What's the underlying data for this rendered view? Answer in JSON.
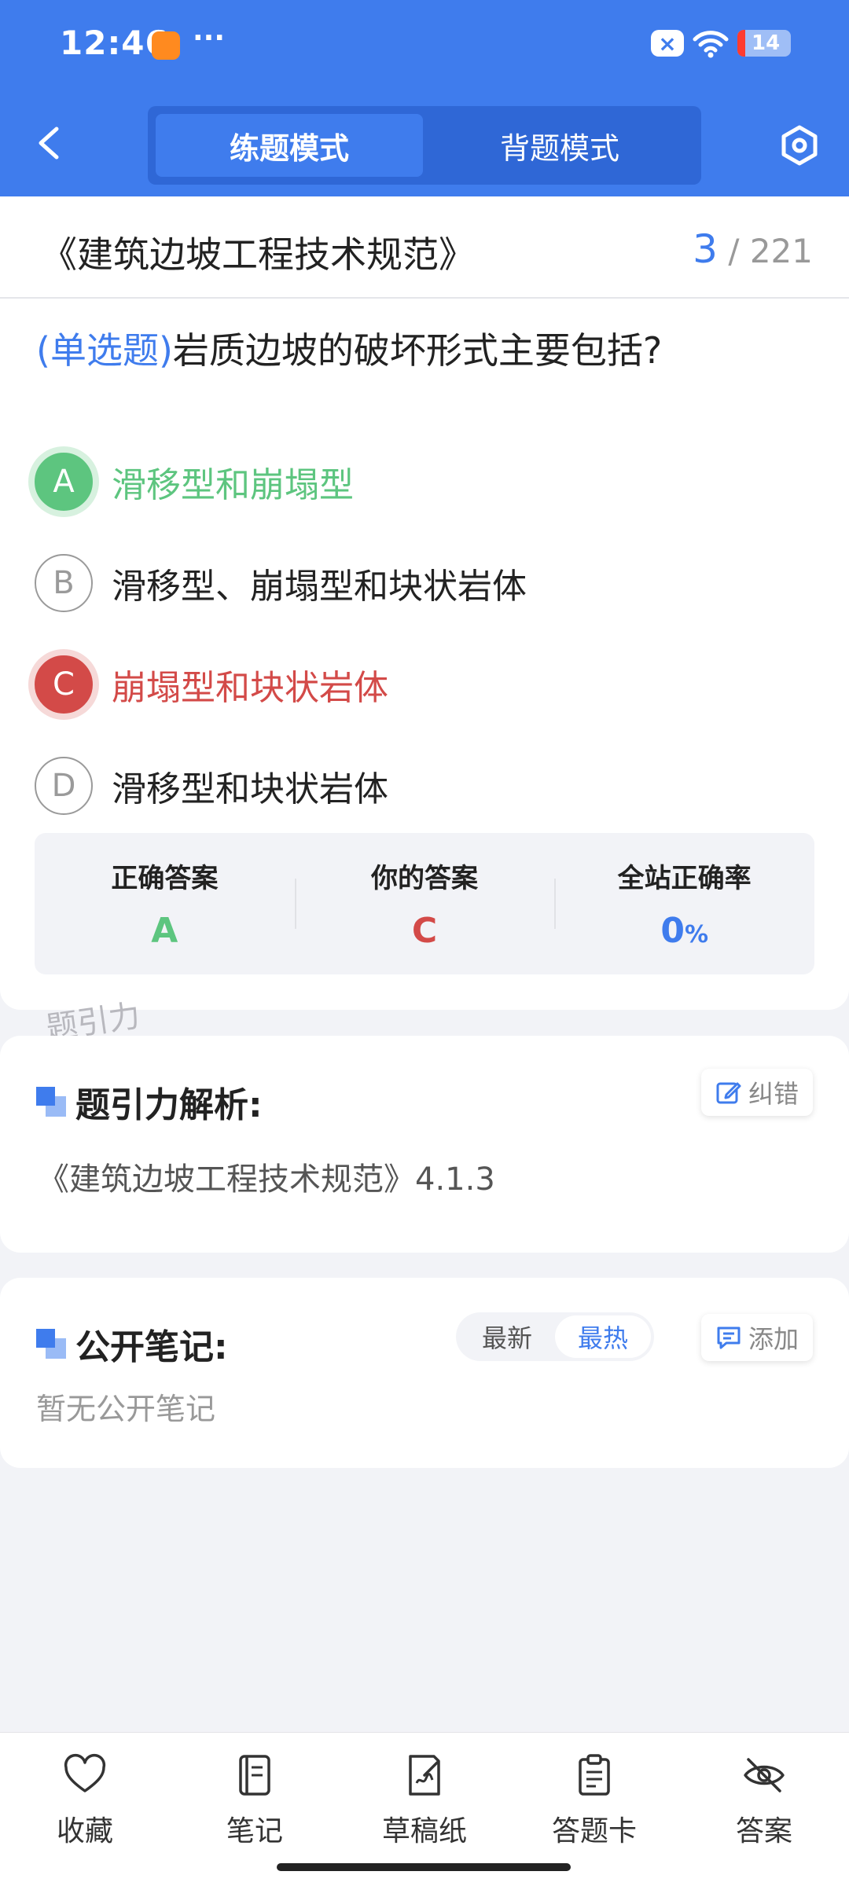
{
  "status_bar": {
    "time": "12:46",
    "dots": "···",
    "battery": "14"
  },
  "header": {
    "modes": [
      "练题模式",
      "背题模式"
    ],
    "active_mode": "练题模式"
  },
  "question": {
    "book_title": "《建筑边坡工程技术规范》",
    "current": "3",
    "total": "/ 221",
    "type": "(单选题)",
    "text": "岩质边坡的破坏形式主要包括?",
    "options": [
      {
        "letter": "A",
        "text": "滑移型和崩塌型",
        "state": "correct"
      },
      {
        "letter": "B",
        "text": "滑移型、崩塌型和块状岩体",
        "state": "none"
      },
      {
        "letter": "C",
        "text": "崩塌型和块状岩体",
        "state": "wrong"
      },
      {
        "letter": "D",
        "text": "滑移型和块状岩体",
        "state": "none"
      }
    ],
    "summary": {
      "correct_label": "正确答案",
      "correct_value": "A",
      "yours_label": "你的答案",
      "yours_value": "C",
      "rate_label": "全站正确率",
      "rate_value": "0",
      "rate_unit": "%"
    }
  },
  "watermark": "题引力",
  "analysis": {
    "title": "题引力解析:",
    "correct_btn": "纠错",
    "text": "《建筑边坡工程技术规范》4.1.3"
  },
  "notes": {
    "title": "公开笔记:",
    "sort_options": [
      "最新",
      "最热"
    ],
    "active_sort": "最热",
    "add_btn": "添加",
    "empty": "暂无公开笔记"
  },
  "bottom_tabs": [
    {
      "label": "收藏",
      "icon": "heart-icon"
    },
    {
      "label": "笔记",
      "icon": "notebook-icon"
    },
    {
      "label": "草稿纸",
      "icon": "draft-icon"
    },
    {
      "label": "答题卡",
      "icon": "clipboard-icon"
    },
    {
      "label": "答案",
      "icon": "eye-off-icon"
    }
  ],
  "colors": {
    "primary": "#3F7CED",
    "correct": "#5DC57F",
    "wrong": "#D34A48"
  }
}
